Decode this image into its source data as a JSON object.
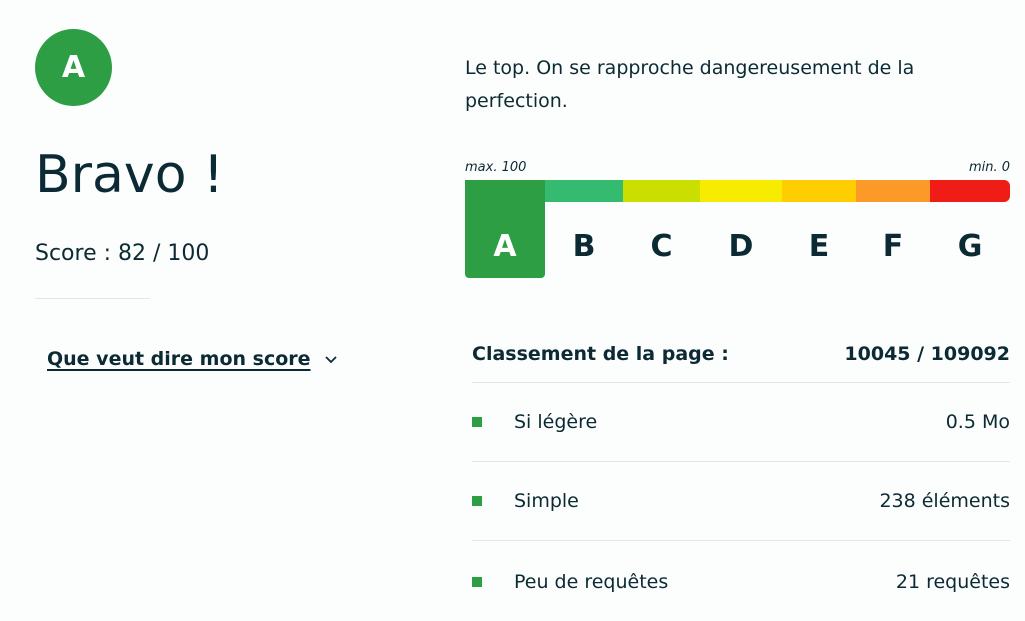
{
  "grade": {
    "letter": "A",
    "color": "#2e9e44"
  },
  "title": "Bravo !",
  "score": {
    "text": "Score : 82 / 100",
    "value": 82,
    "max": 100
  },
  "help_link": {
    "label": "Que veut dire mon score",
    "icon": "chevron-down-icon"
  },
  "description": "Le top. On se rapproche dangereusement de la perfection.",
  "scale": {
    "max_label": "max. 100",
    "min_label": "min. 0",
    "selected": "A",
    "grades": [
      {
        "letter": "A",
        "color": "#2e9e44"
      },
      {
        "letter": "B",
        "color": "#34bb6f"
      },
      {
        "letter": "C",
        "color": "#cadf00"
      },
      {
        "letter": "D",
        "color": "#f7ec00"
      },
      {
        "letter": "E",
        "color": "#fece00"
      },
      {
        "letter": "F",
        "color": "#fb9929"
      },
      {
        "letter": "G",
        "color": "#f01c16"
      }
    ]
  },
  "ranking": {
    "label": "Classement de la page :",
    "value": "10045 / 109092"
  },
  "metrics": [
    {
      "label": "Si légère",
      "value": "0.5 Mo"
    },
    {
      "label": "Simple",
      "value": "238 éléments"
    },
    {
      "label": "Peu de requêtes",
      "value": "21 requêtes"
    }
  ]
}
